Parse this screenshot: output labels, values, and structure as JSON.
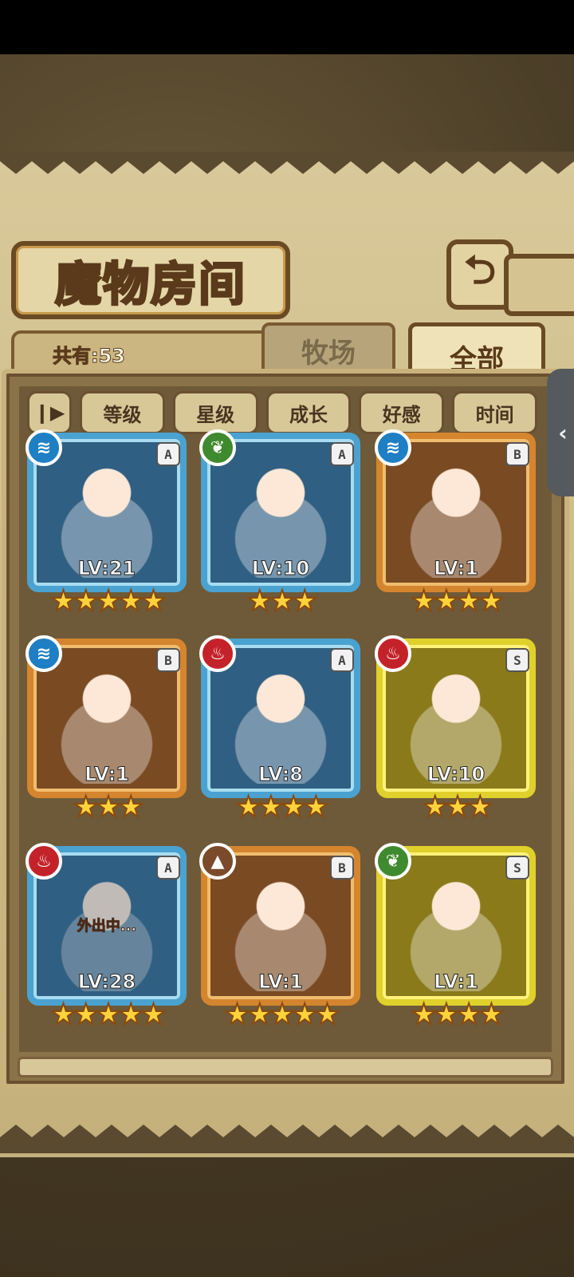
{
  "title": "魔物房间",
  "count_label": "共有:53",
  "tabs": [
    {
      "label": "牧场",
      "active": false
    },
    {
      "label": "全部",
      "active": true
    }
  ],
  "sort_toggle_icon": "pause-toggle-icon",
  "sort_buttons": [
    "等级",
    "星级",
    "成长",
    "好感",
    "时间"
  ],
  "status_text": "外出中...",
  "monsters": [
    {
      "element": "water",
      "rank": "A",
      "level": "LV:21",
      "stars": 5
    },
    {
      "element": "nature",
      "rank": "A",
      "level": "LV:10",
      "stars": 3
    },
    {
      "element": "water",
      "rank": "B",
      "level": "LV:1",
      "stars": 4
    },
    {
      "element": "water",
      "rank": "B",
      "level": "LV:1",
      "stars": 3
    },
    {
      "element": "fire",
      "rank": "A",
      "level": "LV:8",
      "stars": 4
    },
    {
      "element": "fire",
      "rank": "S",
      "level": "LV:10",
      "stars": 3
    },
    {
      "element": "fire",
      "rank": "A",
      "level": "LV:28",
      "stars": 5,
      "status": "外出中..."
    },
    {
      "element": "earth",
      "rank": "B",
      "level": "LV:1",
      "stars": 5
    },
    {
      "element": "nature",
      "rank": "S",
      "level": "LV:1",
      "stars": 4
    }
  ],
  "colors": {
    "water": "#1f7fc4",
    "fire": "#c4222a",
    "nature": "#3f8a2e",
    "earth": "#7a4a2a"
  }
}
